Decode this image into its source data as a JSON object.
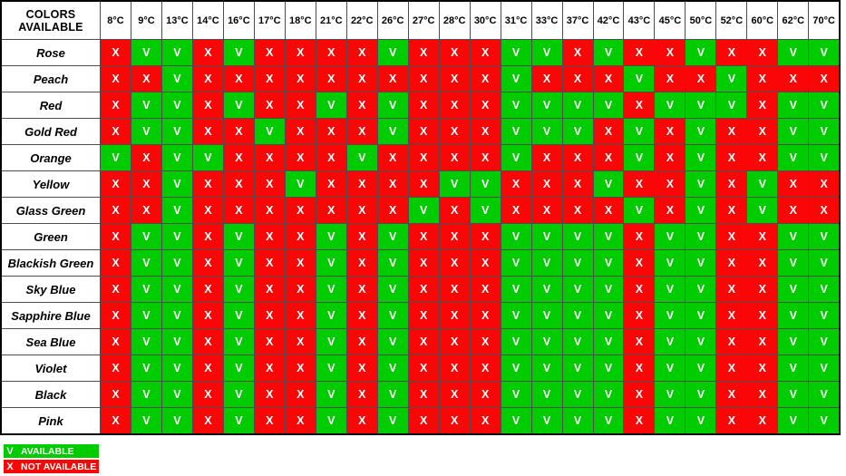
{
  "table": {
    "corner_header_line1": "COLORS",
    "corner_header_line2": "AVAILABLE",
    "columns": [
      "8°C",
      "9°C",
      "13°C",
      "14°C",
      "16°C",
      "17°C",
      "18°C",
      "21°C",
      "22°C",
      "26°C",
      "27°C",
      "28°C",
      "30°C",
      "31°C",
      "33°C",
      "37°C",
      "42°C",
      "43°C",
      "45°C",
      "50°C",
      "52°C",
      "60°C",
      "62°C",
      "70°C"
    ],
    "rows": [
      {
        "label": "Rose",
        "cells": [
          "X",
          "V",
          "V",
          "X",
          "V",
          "X",
          "X",
          "X",
          "X",
          "V",
          "X",
          "X",
          "X",
          "V",
          "V",
          "X",
          "V",
          "X",
          "X",
          "V",
          "X",
          "X",
          "V",
          "V"
        ]
      },
      {
        "label": "Peach",
        "cells": [
          "X",
          "X",
          "V",
          "X",
          "X",
          "X",
          "X",
          "X",
          "X",
          "X",
          "X",
          "X",
          "X",
          "V",
          "X",
          "X",
          "X",
          "V",
          "X",
          "X",
          "V",
          "X",
          "X",
          "X"
        ]
      },
      {
        "label": "Red",
        "cells": [
          "X",
          "V",
          "V",
          "X",
          "V",
          "X",
          "X",
          "V",
          "X",
          "V",
          "X",
          "X",
          "X",
          "V",
          "V",
          "V",
          "V",
          "X",
          "V",
          "V",
          "V",
          "X",
          "V",
          "V"
        ]
      },
      {
        "label": "Gold Red",
        "cells": [
          "X",
          "V",
          "V",
          "X",
          "X",
          "V",
          "X",
          "X",
          "X",
          "V",
          "X",
          "X",
          "X",
          "V",
          "V",
          "V",
          "X",
          "V",
          "X",
          "V",
          "X",
          "X",
          "V",
          "V"
        ]
      },
      {
        "label": "Orange",
        "cells": [
          "V",
          "X",
          "V",
          "V",
          "X",
          "X",
          "X",
          "X",
          "V",
          "X",
          "X",
          "X",
          "X",
          "V",
          "X",
          "X",
          "X",
          "V",
          "X",
          "V",
          "X",
          "X",
          "V",
          "V"
        ]
      },
      {
        "label": "Yellow",
        "cells": [
          "X",
          "X",
          "V",
          "X",
          "X",
          "X",
          "V",
          "X",
          "X",
          "X",
          "X",
          "V",
          "V",
          "X",
          "X",
          "X",
          "V",
          "X",
          "X",
          "V",
          "X",
          "V",
          "X",
          "X"
        ]
      },
      {
        "label": "Glass Green",
        "cells": [
          "X",
          "X",
          "V",
          "X",
          "X",
          "X",
          "X",
          "X",
          "X",
          "X",
          "V",
          "X",
          "V",
          "X",
          "X",
          "X",
          "X",
          "V",
          "X",
          "V",
          "X",
          "V",
          "X",
          "X"
        ]
      },
      {
        "label": "Green",
        "cells": [
          "X",
          "V",
          "V",
          "X",
          "V",
          "X",
          "X",
          "V",
          "X",
          "V",
          "X",
          "X",
          "X",
          "V",
          "V",
          "V",
          "V",
          "X",
          "V",
          "V",
          "X",
          "X",
          "V",
          "V"
        ]
      },
      {
        "label": "Blackish Green",
        "cells": [
          "X",
          "V",
          "V",
          "X",
          "V",
          "X",
          "X",
          "V",
          "X",
          "V",
          "X",
          "X",
          "X",
          "V",
          "V",
          "V",
          "V",
          "X",
          "V",
          "V",
          "X",
          "X",
          "V",
          "V"
        ]
      },
      {
        "label": "Sky Blue",
        "cells": [
          "X",
          "V",
          "V",
          "X",
          "V",
          "X",
          "X",
          "V",
          "X",
          "V",
          "X",
          "X",
          "X",
          "V",
          "V",
          "V",
          "V",
          "X",
          "V",
          "V",
          "X",
          "X",
          "V",
          "V"
        ]
      },
      {
        "label": "Sapphire Blue",
        "cells": [
          "X",
          "V",
          "V",
          "X",
          "V",
          "X",
          "X",
          "V",
          "X",
          "V",
          "X",
          "X",
          "X",
          "V",
          "V",
          "V",
          "V",
          "X",
          "V",
          "V",
          "X",
          "X",
          "V",
          "V"
        ]
      },
      {
        "label": "Sea Blue",
        "cells": [
          "X",
          "V",
          "V",
          "X",
          "V",
          "X",
          "X",
          "V",
          "X",
          "V",
          "X",
          "X",
          "X",
          "V",
          "V",
          "V",
          "V",
          "X",
          "V",
          "V",
          "X",
          "X",
          "V",
          "V"
        ]
      },
      {
        "label": "Violet",
        "cells": [
          "X",
          "V",
          "V",
          "X",
          "V",
          "X",
          "X",
          "V",
          "X",
          "V",
          "X",
          "X",
          "X",
          "V",
          "V",
          "V",
          "V",
          "X",
          "V",
          "V",
          "X",
          "X",
          "V",
          "V"
        ]
      },
      {
        "label": "Black",
        "cells": [
          "X",
          "V",
          "V",
          "X",
          "V",
          "X",
          "X",
          "V",
          "X",
          "V",
          "X",
          "X",
          "X",
          "V",
          "V",
          "V",
          "V",
          "X",
          "V",
          "V",
          "X",
          "X",
          "V",
          "V"
        ]
      },
      {
        "label": "Pink",
        "cells": [
          "X",
          "V",
          "V",
          "X",
          "V",
          "X",
          "X",
          "V",
          "X",
          "V",
          "X",
          "X",
          "X",
          "V",
          "V",
          "V",
          "V",
          "X",
          "V",
          "V",
          "X",
          "X",
          "V",
          "V"
        ]
      }
    ]
  },
  "legend": {
    "available": {
      "symbol": "V",
      "label": "AVAILABLE",
      "color": "#00cc00"
    },
    "not_available": {
      "symbol": "X",
      "label": "NOT AVAILABLE",
      "color": "#f90606"
    }
  }
}
